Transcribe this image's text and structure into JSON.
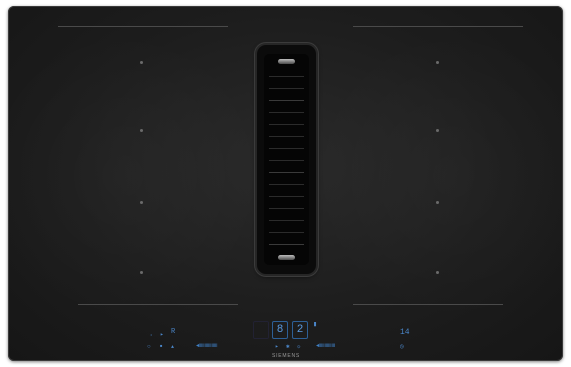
{
  "appliance": {
    "top_label": "",
    "vent_label": "",
    "brand": "SIEMENS",
    "top_right_badge": "",
    "left_zone_marker": "",
    "right_zone_marker": ""
  },
  "controls": {
    "left": {
      "level_display": "",
      "timer_display": "8",
      "boost_display": "2"
    },
    "right": {
      "timer_readout": "14",
      "timer_unit": ""
    },
    "symbols": {
      "left_triangle": "▲",
      "left_arrow": "▸",
      "left_r": "R",
      "left_power": "○",
      "left_lock": "■",
      "left_up": "▲",
      "mid_play": "▸",
      "mid_fan": "✱",
      "mid_light": "☼",
      "right_clock": "◷",
      "left_slider": "◂ıııııııııııııııı",
      "right_slider": "◂ıııııııııııııı"
    }
  },
  "colors": {
    "surface": "#1d1d1d",
    "controls": "#3f7fc4",
    "frame": "#3a3a3a"
  }
}
